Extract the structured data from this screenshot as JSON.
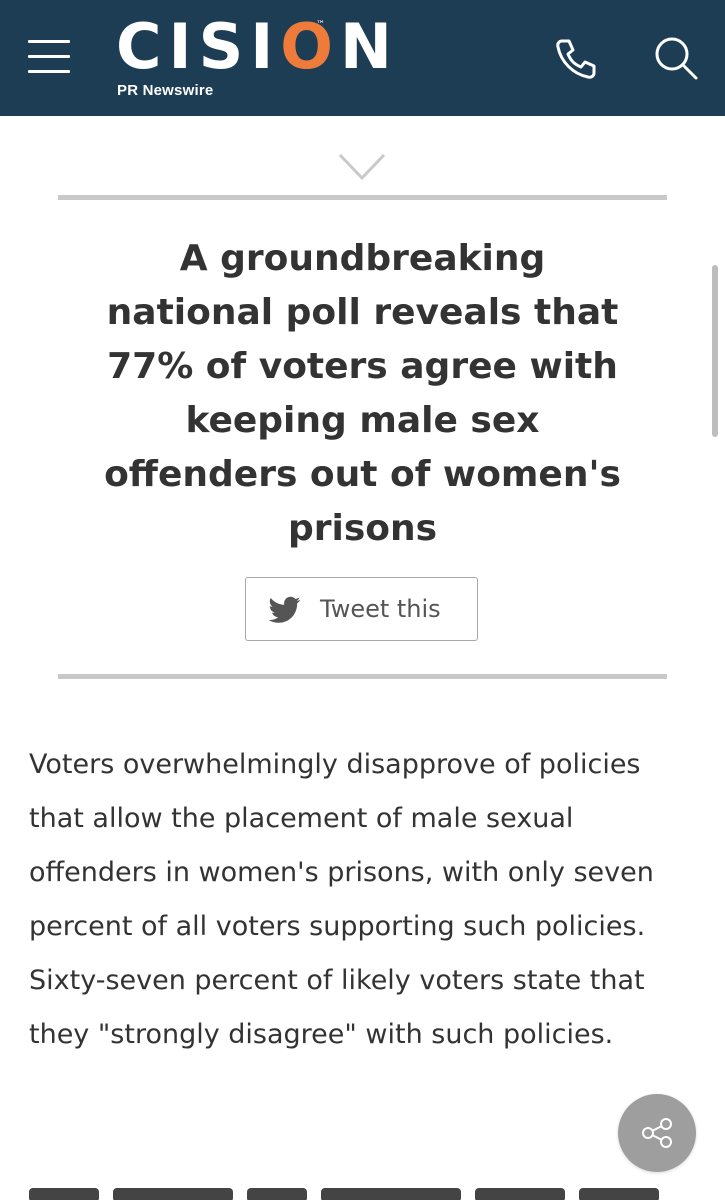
{
  "header": {
    "logo_text": "CISION",
    "logo_subtitle": "PR Newswire",
    "background_color": "#1d3d54",
    "accent_color": "#ef7b3b",
    "menu_icon": "hamburger-icon",
    "phone_icon": "phone-icon",
    "search_icon": "search-icon"
  },
  "summary": {
    "toggle_icon": "chevron-down-icon",
    "headline": "A groundbreaking national poll reveals that 77% of voters agree with keeping male sex offenders out of women's prisons",
    "tweet_label": "Tweet this",
    "tweet_icon": "twitter-bird-icon"
  },
  "article": {
    "paragraph": "Voters overwhelmingly disapprove of policies that allow the placement of male sexual offenders in women's prisons, with only seven percent of all voters supporting such policies. Sixty-seven percent of likely voters state that they \"strongly disagree\" with such policies."
  },
  "share": {
    "icon": "share-icon",
    "color": "#9e9e9e"
  }
}
